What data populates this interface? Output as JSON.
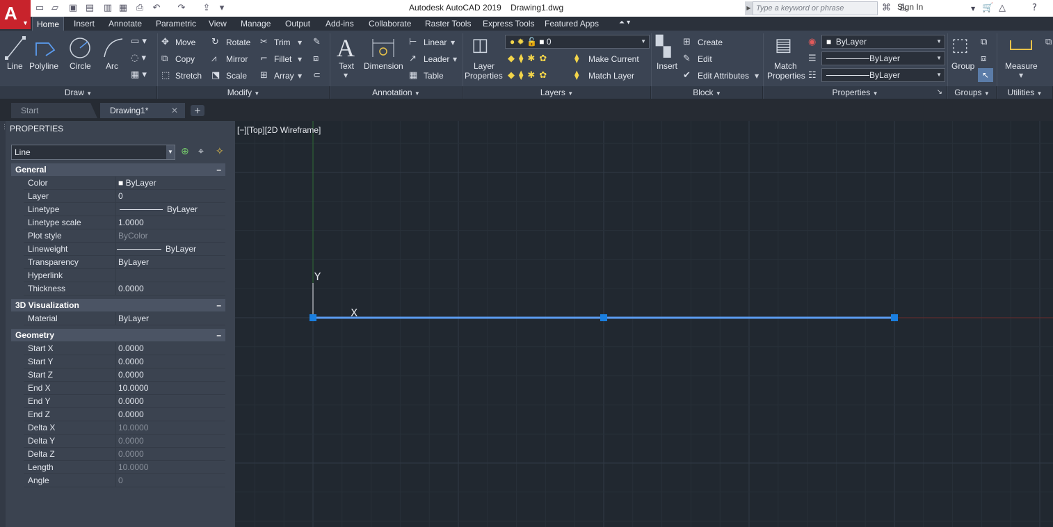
{
  "titlebar": {
    "title": "Autodesk AutoCAD 2019    Drawing1.dwg",
    "search_placeholder": "Type a keyword or phrase",
    "signin": "Sign In"
  },
  "app_button": {
    "label": "A"
  },
  "ribbon_tabs": [
    "Home",
    "Insert",
    "Annotate",
    "Parametric",
    "View",
    "Manage",
    "Output",
    "Add-ins",
    "Collaborate",
    "Raster Tools",
    "Express Tools",
    "Featured Apps"
  ],
  "draw": {
    "line": "Line",
    "polyline": "Polyline",
    "circle": "Circle",
    "arc": "Arc",
    "title": "Draw"
  },
  "modify": {
    "move": "Move",
    "rotate": "Rotate",
    "trim": "Trim",
    "copy": "Copy",
    "mirror": "Mirror",
    "fillet": "Fillet",
    "stretch": "Stretch",
    "scale": "Scale",
    "array": "Array",
    "title": "Modify"
  },
  "annotation": {
    "text": "Text",
    "dimension": "Dimension",
    "linear": "Linear",
    "leader": "Leader",
    "table": "Table",
    "title": "Annotation"
  },
  "layers": {
    "layer_properties_1": "Layer",
    "layer_properties_2": "Properties",
    "current_layer": "0",
    "make_current": "Make Current",
    "match_layer": "Match Layer",
    "title": "Layers"
  },
  "block": {
    "insert": "Insert",
    "create": "Create",
    "edit": "Edit",
    "edit_attributes": "Edit Attributes",
    "title": "Block"
  },
  "properties_panel": {
    "match_1": "Match",
    "match_2": "Properties",
    "color": "ByLayer",
    "linetype": "ByLayer",
    "lineweight": "ByLayer",
    "title": "Properties"
  },
  "groups": {
    "group": "Group",
    "title": "Groups"
  },
  "utilities": {
    "measure": "Measure",
    "title": "Utilities"
  },
  "doc_tabs": {
    "start": "Start",
    "drawing": "Drawing1*",
    "add": "+"
  },
  "palette": {
    "title": "PROPERTIES",
    "selection": "Line",
    "general_title": "General",
    "general": [
      {
        "name": "Color",
        "value": "ByLayer"
      },
      {
        "name": "Layer",
        "value": "0"
      },
      {
        "name": "Linetype",
        "value": "ByLayer"
      },
      {
        "name": "Linetype scale",
        "value": "1.0000"
      },
      {
        "name": "Plot style",
        "value": "ByColor"
      },
      {
        "name": "Lineweight",
        "value": "ByLayer"
      },
      {
        "name": "Transparency",
        "value": "ByLayer"
      },
      {
        "name": "Hyperlink",
        "value": ""
      },
      {
        "name": "Thickness",
        "value": "0.0000"
      }
    ],
    "viz_title": "3D Visualization",
    "viz": [
      {
        "name": "Material",
        "value": "ByLayer"
      }
    ],
    "geom_title": "Geometry",
    "geometry": [
      {
        "name": "Start X",
        "value": "0.0000"
      },
      {
        "name": "Start Y",
        "value": "0.0000"
      },
      {
        "name": "Start Z",
        "value": "0.0000"
      },
      {
        "name": "End X",
        "value": "10.0000"
      },
      {
        "name": "End Y",
        "value": "0.0000"
      },
      {
        "name": "End Z",
        "value": "0.0000"
      },
      {
        "name": "Delta X",
        "value": "10.0000"
      },
      {
        "name": "Delta Y",
        "value": "0.0000"
      },
      {
        "name": "Delta Z",
        "value": "0.0000"
      },
      {
        "name": "Length",
        "value": "10.0000"
      },
      {
        "name": "Angle",
        "value": "0"
      }
    ]
  },
  "viewport": {
    "label": "[−][Top][2D Wireframe]",
    "y_axis": "Y",
    "x_axis": "X"
  },
  "colors": {
    "accent": "#c8232c",
    "selection": "#1a7fe0",
    "line": "#5b9cf0"
  }
}
